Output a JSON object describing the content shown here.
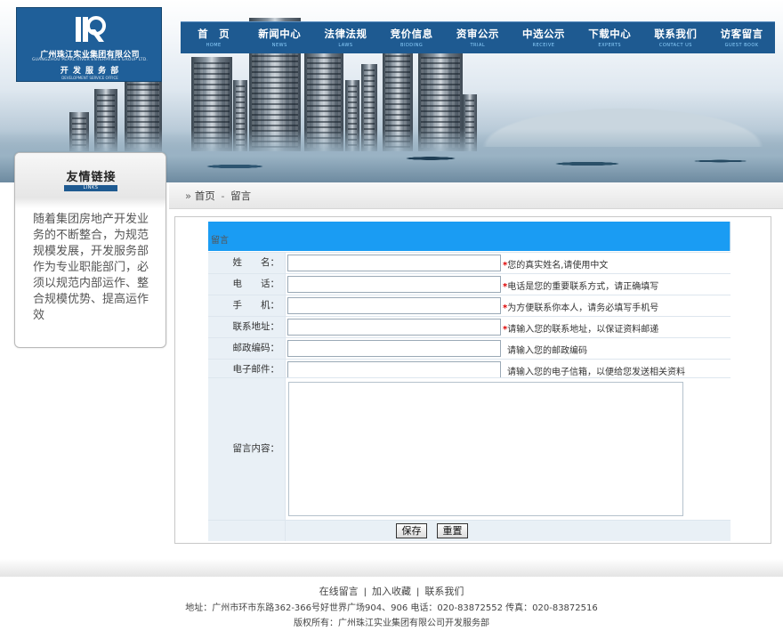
{
  "logo": {
    "company_cn": "广州珠江实业集团有限公司",
    "company_en": "GUANGZHOU PEARL RIVER ENTERPRISES GROUP LTD.",
    "dept_cn": "开 发 服 务 部",
    "dept_en": "DEVELOPMENT SERVICE OFFICE"
  },
  "nav": [
    {
      "cn": "首　页",
      "en": "HOME"
    },
    {
      "cn": "新闻中心",
      "en": "NEWS"
    },
    {
      "cn": "法律法规",
      "en": "LAWS"
    },
    {
      "cn": "竞价信息",
      "en": "BIDDING"
    },
    {
      "cn": "资审公示",
      "en": "TRIAL"
    },
    {
      "cn": "中选公示",
      "en": "RECEIVE"
    },
    {
      "cn": "下载中心",
      "en": "EXPERTS"
    },
    {
      "cn": "联系我们",
      "en": "CONTACT US"
    },
    {
      "cn": "访客留言",
      "en": "GUEST BOOK"
    }
  ],
  "sidebar": {
    "title": "友情链接",
    "title_en": "LINKS",
    "text": "随着集团房地产开发业务的不断整合，为规范规模发展，开发服务部作为专业职能部门，必须以规范内部运作、整合规模优势、提高运作效"
  },
  "breadcrumb": {
    "home": "首页",
    "sep": "-",
    "current": "留言"
  },
  "form": {
    "title": "留言",
    "fields": [
      {
        "label": "姓　　名：",
        "required": "*",
        "hint": "您的真实姓名,请使用中文"
      },
      {
        "label": "电　　话：",
        "required": "*",
        "hint": "电话是您的重要联系方式，请正确填写"
      },
      {
        "label": "手　　机：",
        "required": "*",
        "hint": "为方便联系你本人，请务必填写手机号"
      },
      {
        "label": "联系地址：",
        "required": "*",
        "hint": "请输入您的联系地址，以保证资料邮递"
      },
      {
        "label": "邮政编码：",
        "required": "",
        "hint": "请输入您的邮政编码"
      },
      {
        "label": "电子邮件：",
        "required": "",
        "hint": "请输入您的电子信箱，以便给您发送相关资料"
      }
    ],
    "message_label": "留言内容：",
    "save_label": "保存",
    "reset_label": "重置"
  },
  "footer": {
    "links": [
      "在线留言",
      "加入收藏",
      "联系我们"
    ],
    "address": "地址：广州市环市东路362-366号好世界广场904、906 电话：020-83872552 传真：020-83872516",
    "copyright": "版权所有：广州珠江实业集团有限公司开发服务部"
  },
  "colors": {
    "nav_bg": "#1e5a91",
    "form_title_bg": "#1a9cf3",
    "label_bg": "#e9f0f6",
    "required": "#dd0000"
  }
}
